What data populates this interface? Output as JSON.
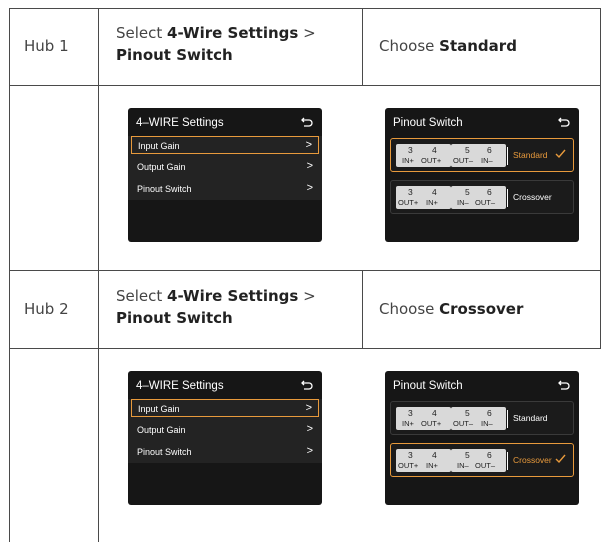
{
  "hub1": {
    "label": "Hub 1",
    "instr_pre": "Select ",
    "instr_bold1": "4-Wire Settings",
    "instr_mid": " >",
    "instr_bold2": "Pinout Switch",
    "choose_pre": "Choose ",
    "choose_bold": "Standard"
  },
  "hub2": {
    "label": "Hub 2",
    "instr_pre": "Select ",
    "instr_bold1": "4-Wire Settings",
    "instr_mid": " >",
    "instr_bold2": "Pinout Switch",
    "choose_pre": "Choose ",
    "choose_bold": "Crossover"
  },
  "settings_screen": {
    "title": "4–WIRE Settings",
    "items": [
      "Input Gain",
      "Output Gain",
      "Pinout Switch"
    ],
    "chevron": ">",
    "selected_index": 0
  },
  "pinout_screen": {
    "title": "Pinout Switch",
    "standard": {
      "n1": "3",
      "n2": "4",
      "s1": "IN+",
      "s2": "OUT+",
      "n3": "5",
      "n4": "6",
      "s3": "OUT–",
      "s4": "IN–",
      "label": "Standard"
    },
    "crossover": {
      "n1": "3",
      "n2": "4",
      "s1": "OUT+",
      "s2": "IN+",
      "n3": "5",
      "n4": "6",
      "s3": "IN–",
      "s4": "OUT–",
      "label": "Crossover"
    }
  },
  "colors": {
    "accent": "#e89a3c",
    "screen_bg": "#161616",
    "pin_bg": "#d9d9d9"
  }
}
